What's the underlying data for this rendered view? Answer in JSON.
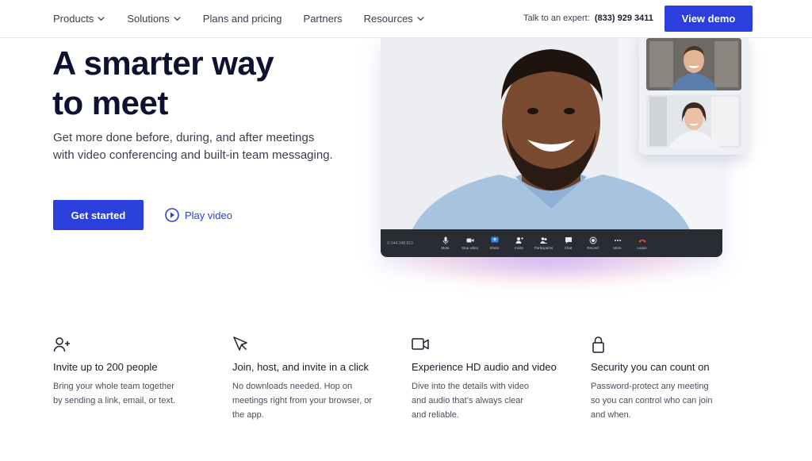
{
  "nav": {
    "items": [
      {
        "label": "Products",
        "dropdown": true
      },
      {
        "label": "Solutions",
        "dropdown": true
      },
      {
        "label": "Plans and pricing",
        "dropdown": false
      },
      {
        "label": "Partners",
        "dropdown": false
      },
      {
        "label": "Resources",
        "dropdown": true
      }
    ],
    "talk_label": "Talk to an expert:",
    "phone": "(833) 929 3411",
    "cta": "View demo"
  },
  "hero": {
    "title_line1": "A smarter way",
    "title_line2": "to meet",
    "subtitle_line1": "Get more done before, during, and after meetings",
    "subtitle_line2": "with video conferencing and built-in team messaging.",
    "primary_cta": "Get started",
    "secondary_cta": "Play video"
  },
  "meeting": {
    "id": "© 544 348 810",
    "tools": [
      "Mute",
      "Stop video",
      "Share",
      "Invite",
      "Participants",
      "Chat",
      "Record",
      "More",
      "Leave"
    ]
  },
  "features": [
    {
      "icon": "add-user-icon",
      "title": "Invite up to 200 people",
      "lines": [
        "Bring your whole team together",
        "by sending a link, email, or text."
      ]
    },
    {
      "icon": "cursor-icon",
      "title": "Join, host, and invite in a click",
      "lines": [
        "No downloads needed. Hop on",
        "meetings right from your browser, or",
        "the app."
      ]
    },
    {
      "icon": "video-camera-icon",
      "title": "Experience HD audio and video",
      "lines": [
        "Dive into the details with video",
        "and audio that’s always clear",
        "and reliable."
      ]
    },
    {
      "icon": "lock-icon",
      "title": "Security you can count on",
      "lines": [
        "Password-protect any meeting",
        "so you can control who can join",
        "and when."
      ]
    }
  ],
  "colors": {
    "accent": "#2b3fdc",
    "heading": "#0e1230",
    "toolbar": "#2a2c33"
  }
}
